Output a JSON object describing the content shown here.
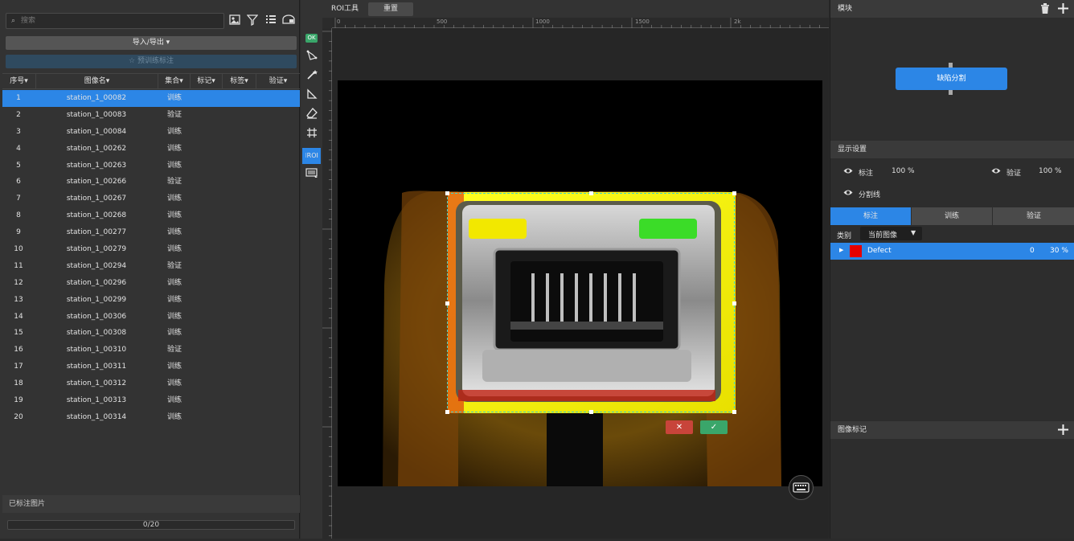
{
  "search": {
    "placeholder": "搜索"
  },
  "left": {
    "import_label": "导入/导出 ▾",
    "pretrain_label": "☆ 预训练标注",
    "columns": [
      "序号▾",
      "图像名▾",
      "集合▾",
      "标记▾",
      "标签▾",
      "验证▾"
    ],
    "rows": [
      {
        "n": "1",
        "name": "station_1_00082",
        "set": "训练"
      },
      {
        "n": "2",
        "name": "station_1_00083",
        "set": "验证"
      },
      {
        "n": "3",
        "name": "station_1_00084",
        "set": "训练"
      },
      {
        "n": "4",
        "name": "station_1_00262",
        "set": "训练"
      },
      {
        "n": "5",
        "name": "station_1_00263",
        "set": "训练"
      },
      {
        "n": "6",
        "name": "station_1_00266",
        "set": "验证"
      },
      {
        "n": "7",
        "name": "station_1_00267",
        "set": "训练"
      },
      {
        "n": "8",
        "name": "station_1_00268",
        "set": "训练"
      },
      {
        "n": "9",
        "name": "station_1_00277",
        "set": "训练"
      },
      {
        "n": "10",
        "name": "station_1_00279",
        "set": "训练"
      },
      {
        "n": "11",
        "name": "station_1_00294",
        "set": "验证"
      },
      {
        "n": "12",
        "name": "station_1_00296",
        "set": "训练"
      },
      {
        "n": "13",
        "name": "station_1_00299",
        "set": "训练"
      },
      {
        "n": "14",
        "name": "station_1_00306",
        "set": "训练"
      },
      {
        "n": "15",
        "name": "station_1_00308",
        "set": "训练"
      },
      {
        "n": "16",
        "name": "station_1_00310",
        "set": "验证"
      },
      {
        "n": "17",
        "name": "station_1_00311",
        "set": "训练"
      },
      {
        "n": "18",
        "name": "station_1_00312",
        "set": "训练"
      },
      {
        "n": "19",
        "name": "station_1_00313",
        "set": "训练"
      },
      {
        "n": "20",
        "name": "station_1_00314",
        "set": "训练"
      }
    ],
    "footer_label": "已标注图片",
    "progress_text": "0/20",
    "progress_fraction": 0.0
  },
  "tools": {
    "ok_label": "OK",
    "roi_label": "⁝ROI"
  },
  "center": {
    "tab_roi": "ROI工具",
    "tab_reset": "重置",
    "ruler_labels": [
      "0",
      "500",
      "1000",
      "1500",
      "2k"
    ],
    "cancel_symbol": "✕",
    "confirm_symbol": "✓"
  },
  "right": {
    "module_title": "模块",
    "module_node": "缺陷分割",
    "display_title": "显示设置",
    "label_name": "标注",
    "label_pct": "100 %",
    "verify_name": "验证",
    "verify_pct": "100 %",
    "seg_line": "分割线",
    "tabs": [
      "标注",
      "训练",
      "验证"
    ],
    "category_label": "类别",
    "category_value": "当前图像",
    "defect_name": "Defect",
    "defect_count": "0",
    "defect_pct": "30 %",
    "image_mark_title": "图像标记"
  },
  "colors": {
    "accent": "#2c86e6",
    "defect": "#e60000",
    "ok_green": "#3aa66a",
    "cancel_red": "#c8443a"
  }
}
